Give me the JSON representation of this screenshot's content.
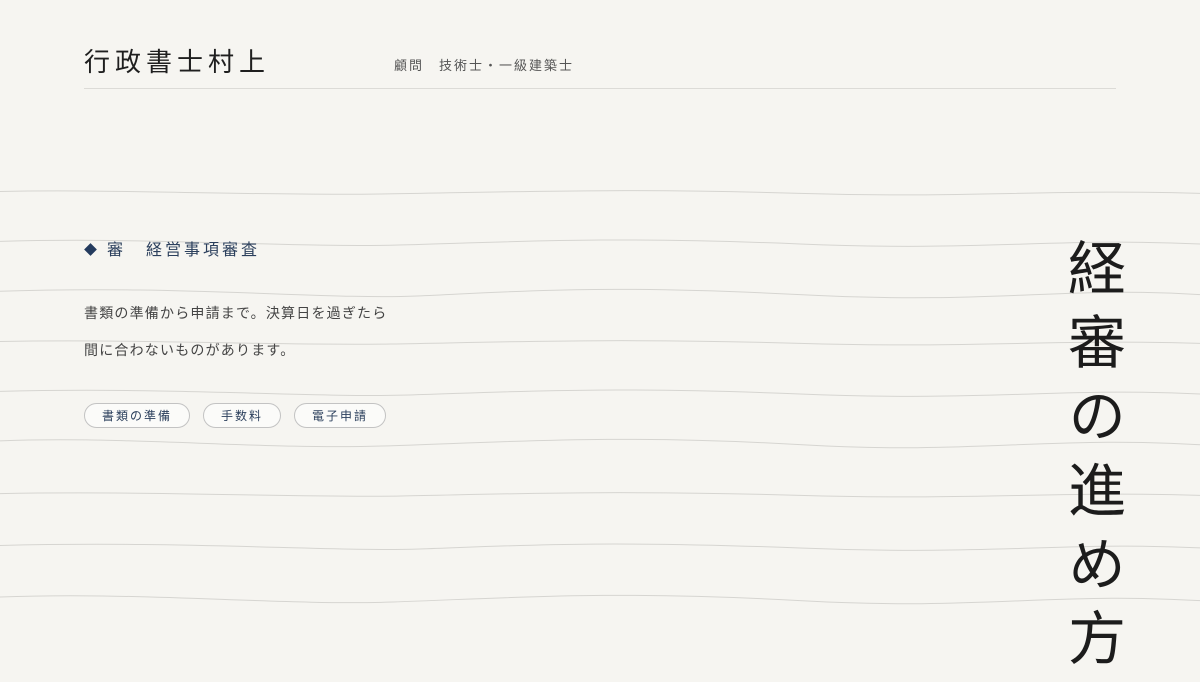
{
  "header": {
    "brand": "行政書士村上",
    "advisor": "顧問　技術士・一級建築士"
  },
  "hero": {
    "eyebrow_mark": "審",
    "eyebrow_text": "経営事項審査",
    "lead_lines": [
      "書類の準備から申請まで。決算日を過ぎたら",
      "間に合わないものがあります。"
    ],
    "tags": [
      "書類の準備",
      "手数料",
      "電子申請"
    ],
    "vertical_title": "経審の進め方"
  },
  "colors": {
    "background": "#f6f5f1",
    "accent": "#243b5e",
    "text": "#1f1f1f",
    "wave_line": "#d6d5d1"
  },
  "icons": {
    "eyebrow_marker": "diamond-icon"
  }
}
